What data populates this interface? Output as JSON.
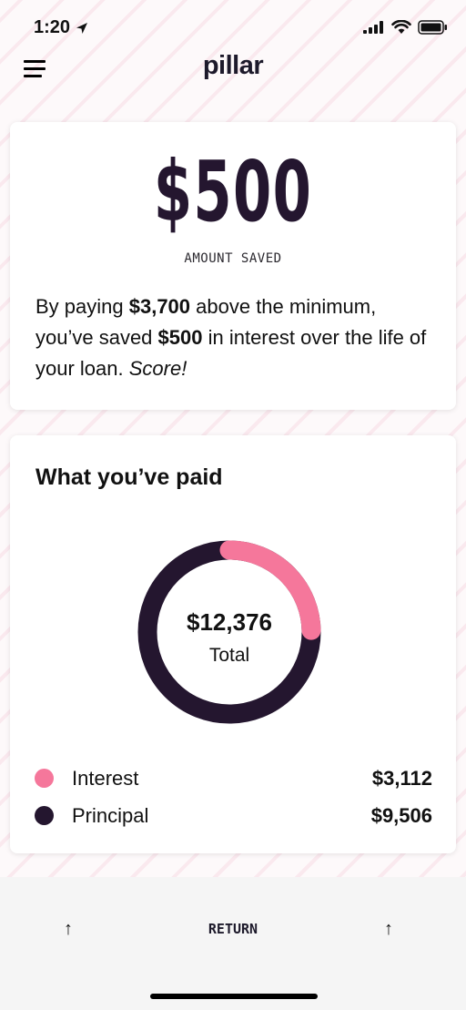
{
  "status_bar": {
    "time": "1:20"
  },
  "header": {
    "logo": "pillar",
    "menu_icon": "hamburger-menu-icon"
  },
  "savings_card": {
    "amount": "$500",
    "amount_label": "AMOUNT SAVED",
    "text_prefix": "By paying ",
    "text_extra_paid": "$3,700",
    "text_middle": " above the minimum, you’ve saved ",
    "text_saved": "$500",
    "text_suffix": " in interest over the life of your loan. ",
    "text_exclaim": "Score!"
  },
  "paid_card": {
    "title": "What you’ve paid",
    "total_value": "$12,376",
    "total_label": "Total",
    "legend": [
      {
        "label": "Interest",
        "value": "$3,112",
        "color": "#f5779b"
      },
      {
        "label": "Principal",
        "value": "$9,506",
        "color": "#24162f"
      }
    ]
  },
  "chart_data": {
    "type": "pie",
    "categories": [
      "Interest",
      "Principal"
    ],
    "values": [
      3112,
      9506
    ],
    "colors": [
      "#f5779b",
      "#24162f"
    ]
  },
  "bottom_bar": {
    "left_arrow": "↑",
    "return_label": "RETURN",
    "right_arrow": "↑"
  }
}
